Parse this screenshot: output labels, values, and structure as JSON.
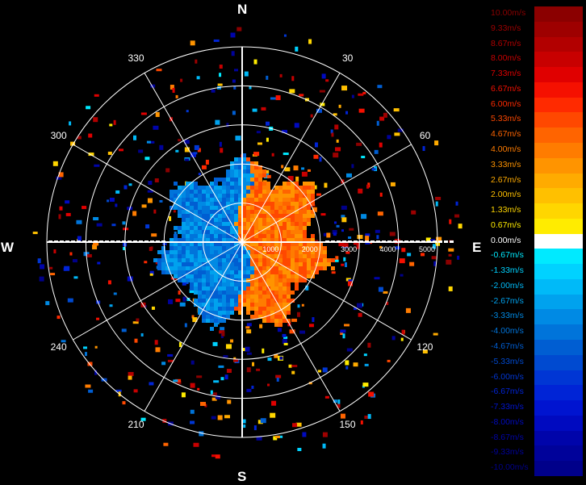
{
  "compass": {
    "north": "N",
    "east": "E",
    "south": "S",
    "west": "W"
  },
  "azimuth_labels": [
    {
      "deg": 30,
      "text": "30"
    },
    {
      "deg": 60,
      "text": "60"
    },
    {
      "deg": 120,
      "text": "120"
    },
    {
      "deg": 150,
      "text": "150"
    },
    {
      "deg": 210,
      "text": "210"
    },
    {
      "deg": 240,
      "text": "240"
    },
    {
      "deg": 300,
      "text": "300"
    },
    {
      "deg": 330,
      "text": "330"
    }
  ],
  "range_labels": [
    "1000",
    "2000",
    "3000",
    "4000",
    "5000"
  ],
  "range_max": 5000,
  "legend": [
    {
      "label": "10.00m/s",
      "color": "#8b0000"
    },
    {
      "label": "9.33m/s",
      "color": "#9e0000"
    },
    {
      "label": "8.67m/s",
      "color": "#b20000"
    },
    {
      "label": "8.00m/s",
      "color": "#c80000"
    },
    {
      "label": "7.33m/s",
      "color": "#e00000"
    },
    {
      "label": "6.67m/s",
      "color": "#f51000"
    },
    {
      "label": "6.00m/s",
      "color": "#ff2a00"
    },
    {
      "label": "5.33m/s",
      "color": "#ff4800"
    },
    {
      "label": "4.67m/s",
      "color": "#ff6400"
    },
    {
      "label": "4.00m/s",
      "color": "#ff7c00"
    },
    {
      "label": "3.33m/s",
      "color": "#ff9400"
    },
    {
      "label": "2.67m/s",
      "color": "#ffab00"
    },
    {
      "label": "2.00m/s",
      "color": "#ffc000"
    },
    {
      "label": "1.33m/s",
      "color": "#ffd600"
    },
    {
      "label": "0.67m/s",
      "color": "#ffec00"
    },
    {
      "label": "0.00m/s",
      "color": "#ffffff"
    },
    {
      "label": "-0.67m/s",
      "color": "#00eaff"
    },
    {
      "label": "-1.33m/s",
      "color": "#00d2ff"
    },
    {
      "label": "-2.00m/s",
      "color": "#00baf8"
    },
    {
      "label": "-2.67m/s",
      "color": "#00a2ee"
    },
    {
      "label": "-3.33m/s",
      "color": "#008ae4"
    },
    {
      "label": "-4.00m/s",
      "color": "#0074da"
    },
    {
      "label": "-4.67m/s",
      "color": "#005ed2"
    },
    {
      "label": "-5.33m/s",
      "color": "#004ad0"
    },
    {
      "label": "-6.00m/s",
      "color": "#0036d4"
    },
    {
      "label": "-6.67m/s",
      "color": "#0024d6"
    },
    {
      "label": "-7.33m/s",
      "color": "#0014d0"
    },
    {
      "label": "-8.00m/s",
      "color": "#000ac0"
    },
    {
      "label": "-8.67m/s",
      "color": "#0004aa"
    },
    {
      "label": "-9.33m/s",
      "color": "#00029a"
    },
    {
      "label": "-10.00m/s",
      "color": "#00008a"
    }
  ]
}
